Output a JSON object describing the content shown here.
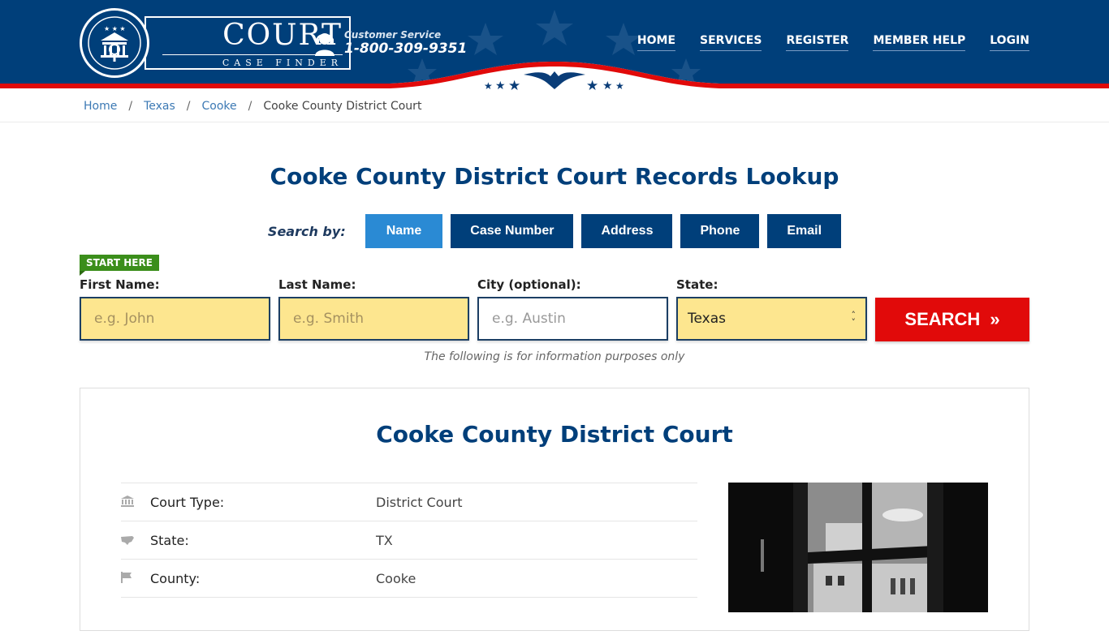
{
  "header": {
    "logo_title": "COURT",
    "logo_subtitle": "CASE FINDER",
    "customer_service_label": "Customer Service",
    "customer_service_phone": "1-800-309-9351",
    "nav": [
      "HOME",
      "SERVICES",
      "REGISTER",
      "MEMBER HELP",
      "LOGIN"
    ],
    "colors": {
      "primary": "#003f7a",
      "accent_red": "#e10a0a",
      "active_tab": "#2a8ad4",
      "input_highlight": "#fde68f"
    }
  },
  "breadcrumb": [
    "Home",
    "Texas",
    "Cooke",
    "Cooke County District Court"
  ],
  "page_title": "Cooke County District Court Records Lookup",
  "search": {
    "label": "Search by:",
    "tabs": [
      "Name",
      "Case Number",
      "Address",
      "Phone",
      "Email"
    ],
    "active_tab": "Name",
    "start_here": "START HERE",
    "fields": [
      {
        "label": "First Name:",
        "placeholder": "e.g. John",
        "value": ""
      },
      {
        "label": "Last Name:",
        "placeholder": "e.g. Smith",
        "value": ""
      },
      {
        "label": "City (optional):",
        "placeholder": "e.g.  Austin",
        "value": ""
      },
      {
        "label": "State:",
        "value": "Texas"
      }
    ],
    "button": "SEARCH",
    "button_icon": "»"
  },
  "disclaimer": "The following is for information purposes only",
  "court": {
    "name": "Cooke County District Court",
    "details": [
      {
        "icon": "courthouse-icon",
        "key": "Court Type:",
        "value": "District Court"
      },
      {
        "icon": "usa-map-icon",
        "key": "State:",
        "value": "TX"
      },
      {
        "icon": "flag-icon",
        "key": "County:",
        "value": "Cooke"
      }
    ]
  }
}
